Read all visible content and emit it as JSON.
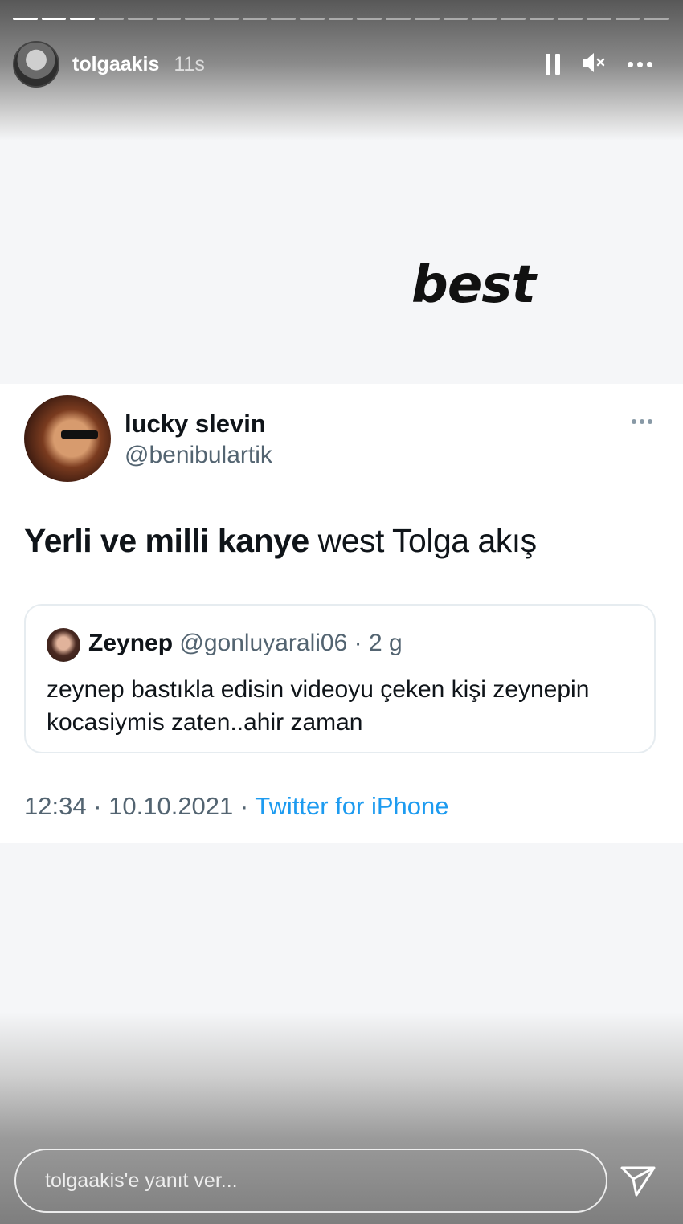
{
  "story": {
    "progress": {
      "total_segments": 23,
      "completed_segments": 3
    },
    "username": "tolgaakis",
    "timestamp": "11s",
    "controls": [
      "pause-icon",
      "mute-icon",
      "more-icon"
    ]
  },
  "caption": "best",
  "tweet": {
    "display_name": "lucky slevin",
    "handle": "@benibulartik",
    "text_bold": "Yerli ve milli kanye",
    "text_rest": " west Tolga akış",
    "quote": {
      "name": "Zeynep",
      "meta": " @gonluyarali06 · 2 g",
      "text": "zeynep bastıkla edisin videoyu çeken kişi zeynepin kocasiymis zaten..ahir zaman"
    },
    "footer_time": "12:34 · 10.10.2021 · ",
    "footer_source": "Twitter for iPhone"
  },
  "reply": {
    "placeholder": "tolgaakis'e yanıt ver..."
  }
}
